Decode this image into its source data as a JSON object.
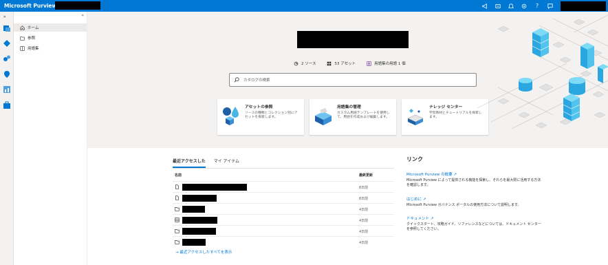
{
  "app": {
    "brand": "Microsoft Purview"
  },
  "nav": {
    "items": [
      {
        "label": "ホーム",
        "icon": "home-icon"
      },
      {
        "label": "参照",
        "icon": "folder-icon"
      },
      {
        "label": "用語集",
        "icon": "book-icon"
      }
    ]
  },
  "hero": {
    "stats": [
      {
        "label": "2 ソース",
        "icon": "source-icon"
      },
      {
        "label": "53 アセット",
        "icon": "asset-icon"
      },
      {
        "label": "用語集の用語 1 個",
        "icon": "glossary-icon"
      }
    ],
    "search_placeholder": "カタログの検索",
    "cards": [
      {
        "title": "アセットの参照",
        "desc": "ソースの種類とコレクション別にアセットを探索します。"
      },
      {
        "title": "用語集の管理",
        "desc": "カスタム用語テンプレートを使用して、用語を作成および編集します。"
      },
      {
        "title": "ナレッジ センター",
        "desc": "学習教材とチュートリアルを探索します。"
      }
    ]
  },
  "recent": {
    "tabs": [
      "最近アクセスした",
      "マイ アイテム"
    ],
    "col_name": "名前",
    "col_time": "最終更新",
    "rows": [
      {
        "time": "8日前"
      },
      {
        "time": "8日前"
      },
      {
        "time": "4日前"
      },
      {
        "time": "4日前"
      },
      {
        "time": "4日前"
      },
      {
        "time": "4日前"
      }
    ],
    "view_all": "最近アクセスしたすべてを表示"
  },
  "links": {
    "title": "リンク",
    "items": [
      {
        "title": "Microsoft Purview の概要",
        "desc": "Microsoft Purview によって提供される機能を探索し、それらを最大限に活用する方法を確認します。"
      },
      {
        "title": "はじめに",
        "desc": "Microsoft Purview ガバナンス ポータルの使用方法について説明します。"
      },
      {
        "title": "ドキュメント",
        "desc": "クイックスタート、攻略ガイド、リファレンスなどについては、ドキュメント センターを参照してください。"
      }
    ]
  },
  "colors": {
    "accent": "#0078d4",
    "hero_bg": "#f3f2f1",
    "iso_blue": "#2aa7e0",
    "iso_cyan": "#5fd4f4"
  }
}
